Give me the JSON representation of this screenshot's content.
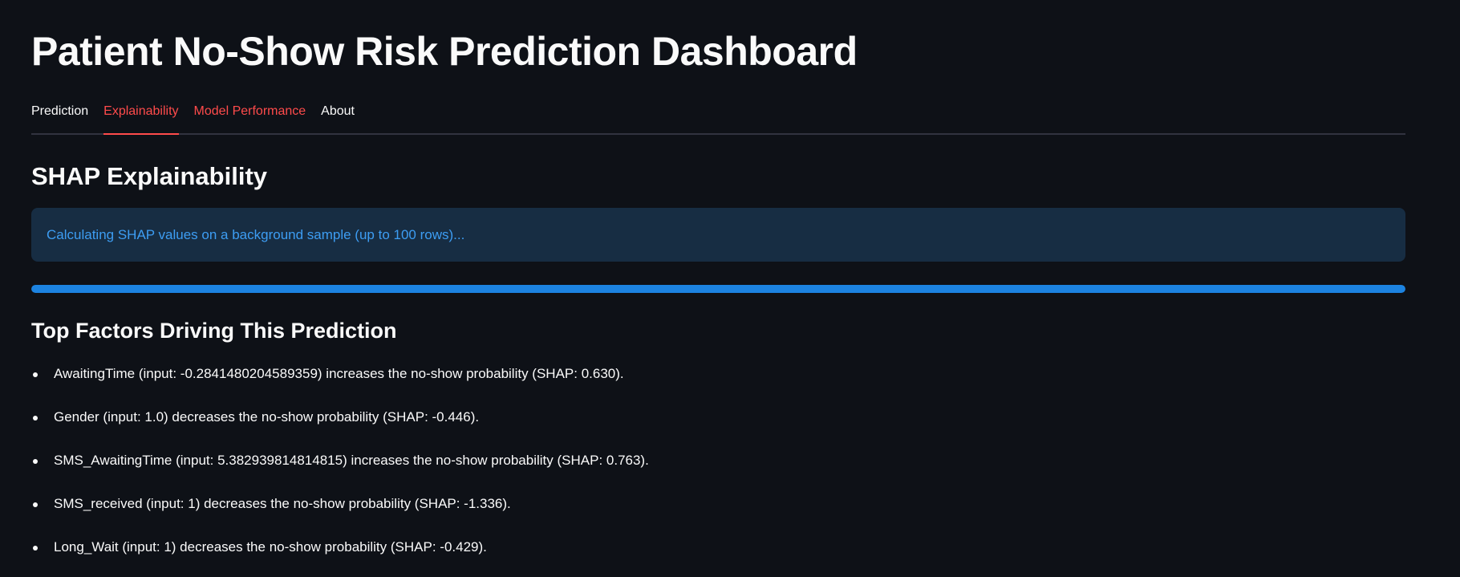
{
  "header": {
    "title": "Patient No-Show Risk Prediction Dashboard"
  },
  "tabs": [
    {
      "label": "Prediction"
    },
    {
      "label": "Explainability"
    },
    {
      "label": "Model Performance"
    },
    {
      "label": "About"
    }
  ],
  "explainability": {
    "section_title": "SHAP Explainability",
    "info_message": "Calculating SHAP values on a background sample (up to 100 rows)...",
    "progress": 1.0,
    "factors_title": "Top Factors Driving This Prediction",
    "factors": [
      "AwaitingTime (input: -0.2841480204589359) increases the no-show probability (SHAP: 0.630).",
      "Gender (input: 1.0) decreases the no-show probability (SHAP: -0.446).",
      "SMS_AwaitingTime (input: 5.382939814814815) increases the no-show probability (SHAP: 0.763).",
      "SMS_received (input: 1) decreases the no-show probability (SHAP: -1.336).",
      "Long_Wait (input: 1) decreases the no-show probability (SHAP: -0.429)."
    ]
  },
  "colors": {
    "background": "#0e1117",
    "accent": "#ff4b4b",
    "info_bg": "#172d43",
    "info_text": "#3d9df3",
    "progress": "#1c83e1"
  }
}
